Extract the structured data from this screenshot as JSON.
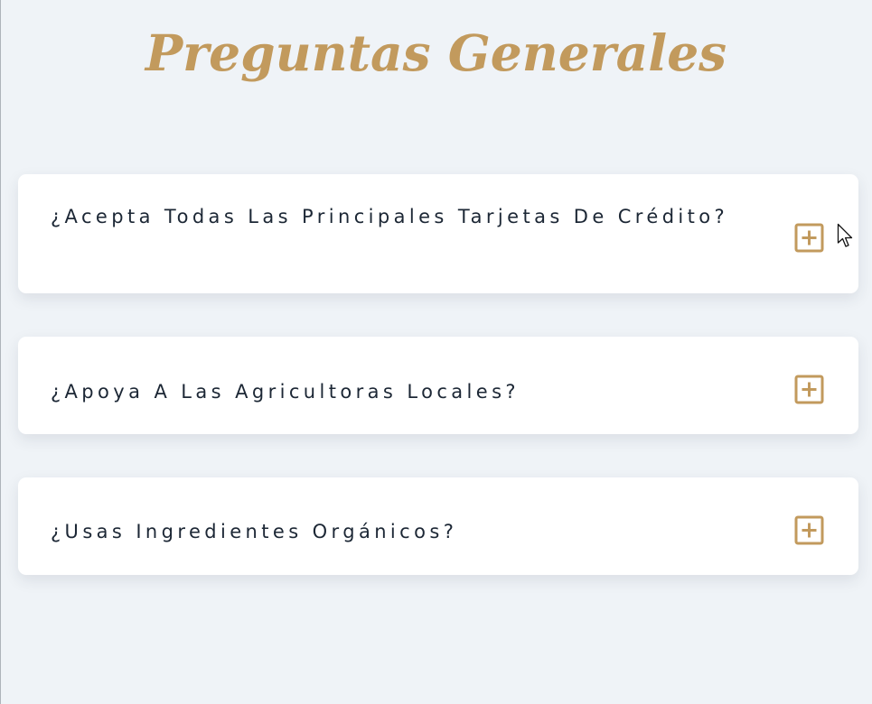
{
  "title": "Preguntas Generales",
  "faqs": [
    {
      "question": "¿Acepta Todas Las Principales Tarjetas De Crédito?",
      "expanded": false
    },
    {
      "question": "¿Apoya A Las Agricultoras Locales?",
      "expanded": false
    },
    {
      "question": "¿Usas Ingredientes Orgánicos?",
      "expanded": false
    }
  ],
  "colors": {
    "accent": "#c29a5d",
    "background": "#eff3f7",
    "card": "#ffffff",
    "text": "#1c2735"
  },
  "icons": {
    "toggle": "plus-square-icon",
    "pointer": "mouse-pointer-icon"
  }
}
